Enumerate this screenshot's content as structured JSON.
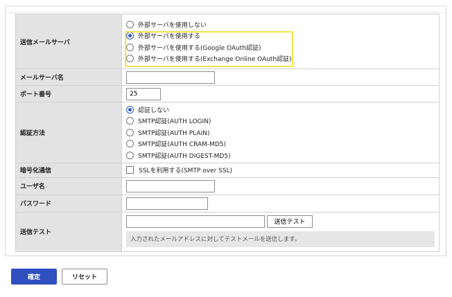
{
  "form": {
    "smtp_server": {
      "label": "送信メールサーバ",
      "options": [
        "外部サーバを使用しない",
        "外部サーバを使用する",
        "外部サーバを使用する(Google OAuth認証)",
        "外部サーバを使用する(Exchange Online OAuth認証)"
      ],
      "selected_index": 1
    },
    "server_name": {
      "label": "メールサーバ名",
      "value": ""
    },
    "port": {
      "label": "ポート番号",
      "value": "25"
    },
    "auth_method": {
      "label": "認証方法",
      "options": [
        "認証しない",
        "SMTP認証(AUTH LOGIN)",
        "SMTP認証(AUTH PLAIN)",
        "SMTP認証(AUTH CRAM-MD5)",
        "SMTP認証(AUTH DIGEST-MD5)"
      ],
      "selected_index": 0
    },
    "encryption": {
      "label": "暗号化通信",
      "checkbox_label": "SSLを利用する(SMTP over SSL)",
      "checked": false
    },
    "username": {
      "label": "ユーザ名",
      "value": ""
    },
    "password": {
      "label": "パスワード",
      "value": ""
    },
    "send_test": {
      "label": "送信テスト",
      "address_value": "",
      "button_label": "送信テスト",
      "note": "入力されたメールアドレスに対してテストメールを送信します。"
    }
  },
  "footer": {
    "confirm_label": "確定",
    "reset_label": "リセット"
  },
  "colors": {
    "primary": "#2f4fbf",
    "highlight": "#f3e24a",
    "radio_checked": "#2a56c6",
    "label_bg": "#e3e3e3"
  }
}
